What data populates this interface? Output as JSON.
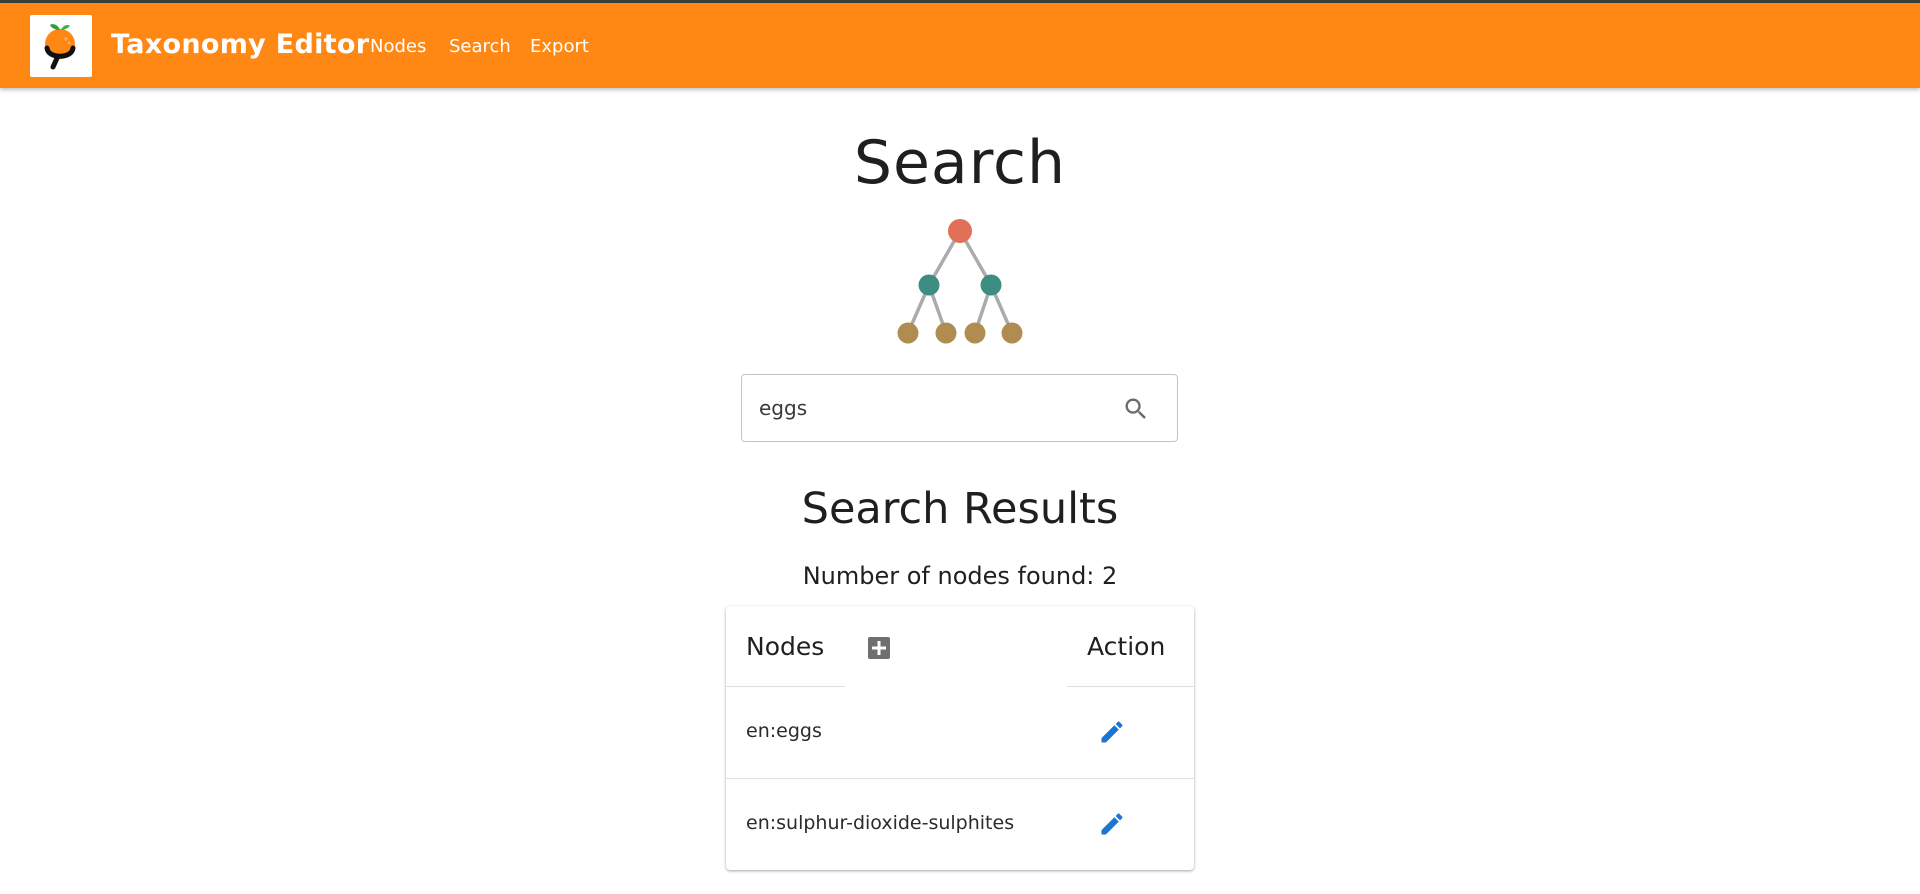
{
  "header": {
    "title": "Taxonomy Editor",
    "logo_icon": "open-food-facts-logo-icon",
    "background_color": "#ff8714",
    "nav": [
      {
        "label": "Nodes"
      },
      {
        "label": "Search"
      },
      {
        "label": "Export"
      }
    ]
  },
  "main": {
    "heading": "Search",
    "illustration_icon": "tree-diagram-icon",
    "search": {
      "value": "eggs",
      "icon": "search-icon"
    },
    "results_heading": "Search Results",
    "results_count_text": "Number of nodes found: 2",
    "table": {
      "columns": {
        "nodes": "Nodes",
        "add_icon": "add-box-icon",
        "action": "Action"
      },
      "rows": [
        {
          "node": "en:eggs",
          "action_icon": "edit-pencil-icon"
        },
        {
          "node": "en:sulphur-dioxide-sulphites",
          "action_icon": "edit-pencil-icon"
        }
      ]
    }
  },
  "colors": {
    "edit_icon": "#1976d2",
    "tree_root": "#e07058",
    "tree_middle": "#3d8d82",
    "tree_leaf": "#b08c50",
    "tree_edge": "#ababab"
  }
}
